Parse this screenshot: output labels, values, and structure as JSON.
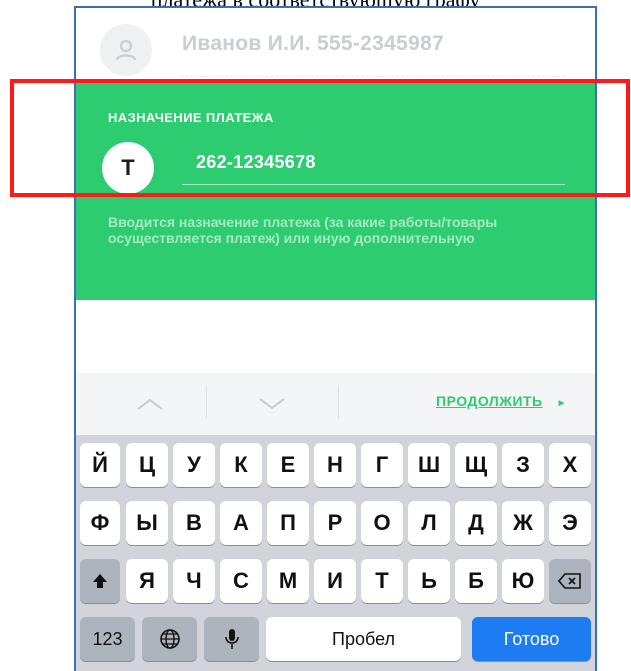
{
  "caption": "платежа в соответствующую графу",
  "contact": {
    "text": "Иванов И.И. 555-2345987"
  },
  "purpose": {
    "title": "НАЗНАЧЕНИЕ ПЛАТЕЖА",
    "icon_letter": "Т",
    "value": "262-12345678",
    "hint": "Вводится назначение платежа (за какие работы/товары осуществляется платеж) или иную дополнительную"
  },
  "toolbar": {
    "continue_label": "ПРОДОЛЖИТЬ",
    "continue_arrow": "►"
  },
  "keyboard": {
    "row1": [
      "Й",
      "Ц",
      "У",
      "К",
      "Е",
      "Н",
      "Г",
      "Ш",
      "Щ",
      "З",
      "Х"
    ],
    "row2": [
      "Ф",
      "Ы",
      "В",
      "А",
      "П",
      "Р",
      "О",
      "Л",
      "Д",
      "Ж",
      "Э"
    ],
    "row3": [
      "Я",
      "Ч",
      "С",
      "М",
      "И",
      "Т",
      "Ь",
      "Б",
      "Ю"
    ],
    "numbers_label": "123",
    "space_label": "Пробел",
    "done_label": "Готово"
  },
  "colors": {
    "green": "#2ecc71",
    "highlight": "#ff1a1a",
    "done_blue": "#1d7cf2"
  }
}
